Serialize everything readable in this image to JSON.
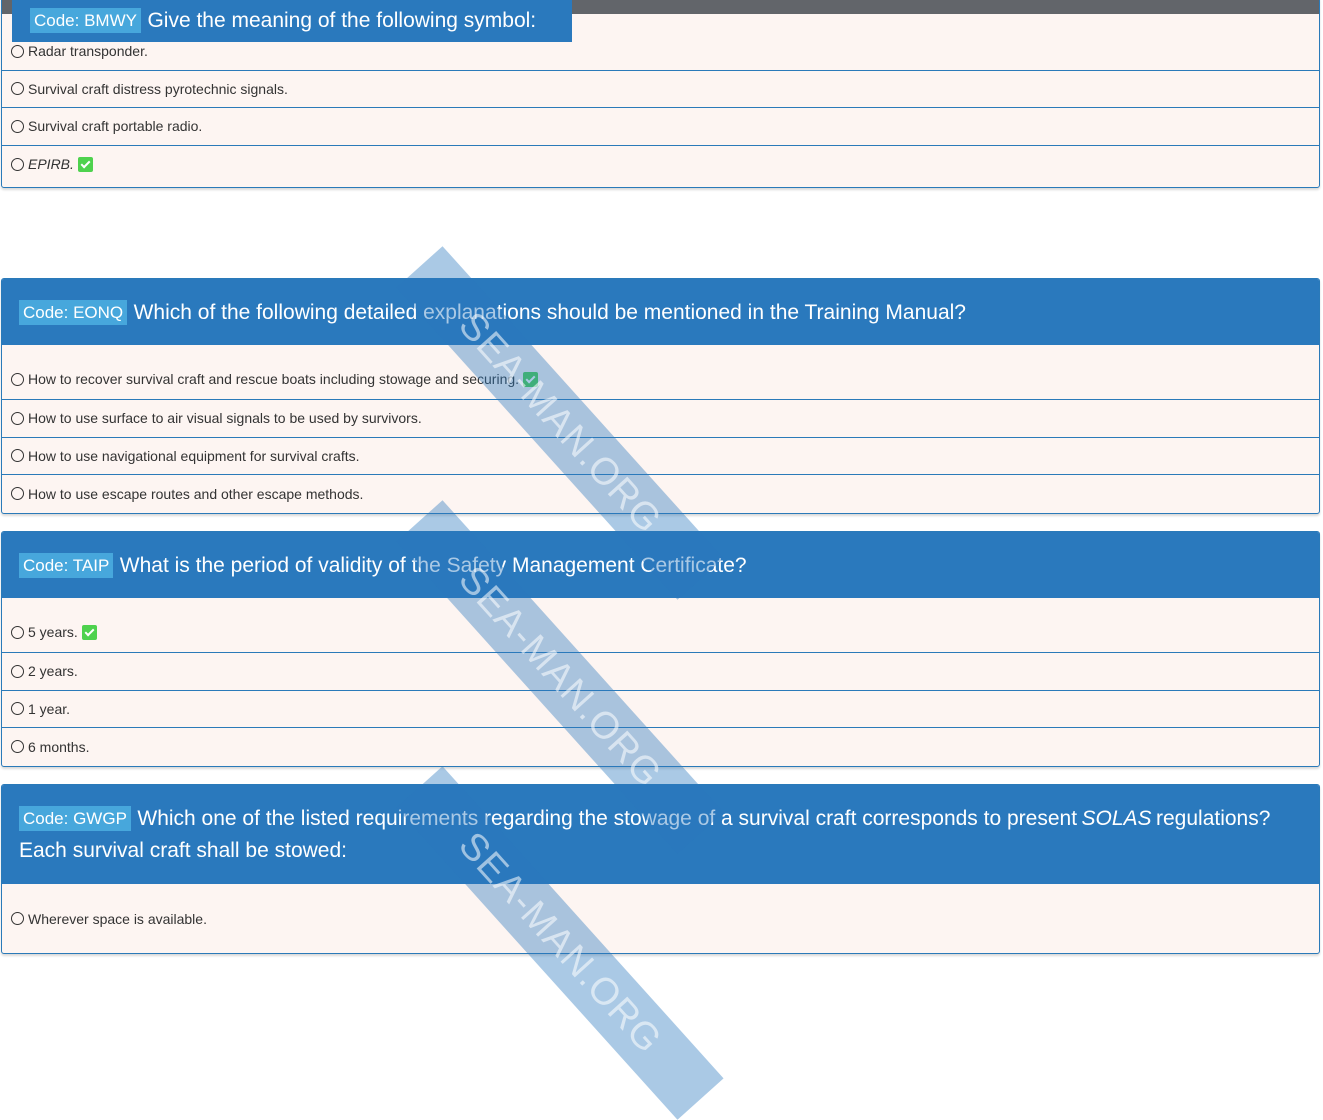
{
  "questions": [
    {
      "code": "Code: BMWY",
      "text": "Give the meaning of the following symbol:",
      "options": [
        {
          "label": "Radar transponder.",
          "correct": false
        },
        {
          "label": "Survival craft distress pyrotechnic signals.",
          "correct": false
        },
        {
          "label": "Survival craft portable radio.",
          "correct": false
        },
        {
          "label": "EPIRB.",
          "correct": true
        }
      ]
    },
    {
      "code": "Code: EONQ",
      "text": "Which of the following detailed explanations should be mentioned in the Training Manual?",
      "options": [
        {
          "label": "How to recover survival craft and rescue boats including stowage and securing.",
          "correct": true
        },
        {
          "label": "How to use surface to air visual signals to be used by survivors.",
          "correct": false
        },
        {
          "label": "How to use navigational equipment for survival crafts.",
          "correct": false
        },
        {
          "label": "How to use escape routes and other escape methods.",
          "correct": false
        }
      ]
    },
    {
      "code": "Code: TAIP",
      "text": "What is the period of validity of the Safety Management Certificate?",
      "options": [
        {
          "label": "5 years.",
          "correct": true
        },
        {
          "label": "2 years.",
          "correct": false
        },
        {
          "label": "1 year.",
          "correct": false
        },
        {
          "label": "6 months.",
          "correct": false
        }
      ]
    },
    {
      "code": "Code: GWGP",
      "text_part1": "Which one of the listed requirements regarding the stowage of a survival craft corresponds to present",
      "text_italic": "SOLAS",
      "text_part2": "regulations?",
      "text_line2": "Each survival craft shall be stowed:",
      "options": [
        {
          "label": "Wherever space is available.",
          "correct": false
        }
      ]
    }
  ],
  "watermark": "SEA-MAN.ORG",
  "colors": {
    "header": "#2a79bd",
    "code_badge": "#47a7dc",
    "card_bg": "#fdf5f2",
    "check": "#4ed24e"
  }
}
